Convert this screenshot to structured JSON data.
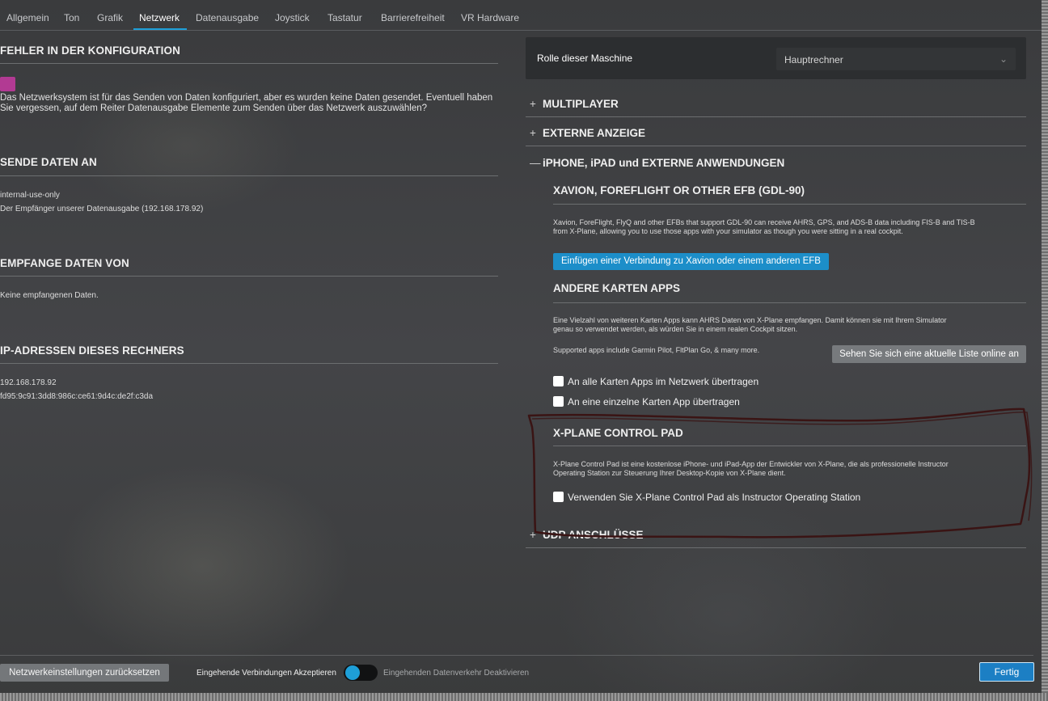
{
  "tabs": [
    "Allgemein",
    "Ton",
    "Grafik",
    "Netzwerk",
    "Datenausgabe",
    "Joystick",
    "Tastatur",
    "Barrierefreiheit",
    "VR Hardware"
  ],
  "active_tab": "Netzwerk",
  "left": {
    "config_error": {
      "title": "FEHLER IN DER KONFIGURATION",
      "line1": "Das Netzwerksystem ist für das Senden von Daten konfiguriert, aber es wurden keine Daten gesendet. Eventuell haben",
      "line2": "Sie vergessen, auf dem Reiter Datenausgabe Elemente zum Senden über das Netzwerk auszuwählen?"
    },
    "send_to": {
      "title": "SENDE DATEN AN",
      "item1": "internal-use-only",
      "item2": "Der Empfänger unserer Datenausgabe (192.168.178.92)"
    },
    "receive_from": {
      "title": "EMPFANGE DATEN VON",
      "item1": "Keine empfangenen Daten."
    },
    "ip": {
      "title": "IP-ADRESSEN DIESES RECHNERS",
      "item1": "192.168.178.92",
      "item2": "fd95:9c91:3dd8:986c:ce61:9d4c:de2f:c3da"
    }
  },
  "right": {
    "role_label": "Rolle dieser Maschine",
    "role_value": "Hauptrechner",
    "sections": {
      "multiplayer": "MULTIPLAYER",
      "external_display": "EXTERNE ANZEIGE",
      "iphone": "iPHONE, iPAD und EXTERNE ANWENDUNGEN",
      "udp": "UDP ANSCHLÜSSE"
    },
    "signs": {
      "plus": "+",
      "minus": "—"
    },
    "xavion": {
      "title": "XAVION, FOREFLIGHT OR OTHER EFB (GDL-90)",
      "line1": "Xavion, ForeFlight, FlyQ and other EFBs that support GDL-90 can receive AHRS, GPS, and ADS-B data including FIS-B and TIS-B",
      "line2": "from X-Plane, allowing you to use those apps with your simulator as though you were sitting in a real cockpit.",
      "button": "Einfügen einer Verbindung zu Xavion oder einem anderen EFB"
    },
    "maps": {
      "title": "ANDERE KARTEN APPS",
      "line1": "Eine Vielzahl von weiteren Karten Apps kann AHRS Daten von X-Plane empfangen. Damit können sie mit Ihrem Simulator",
      "line2": "genau so verwendet werden, als würden Sie in einem realen Cockpit sitzen.",
      "supported": "Supported apps include Garmin Pilot, FltPlan Go, & many more.",
      "list_button": "Sehen Sie sich eine aktuelle Liste online an",
      "check_all": "An alle Karten Apps im Netzwerk übertragen",
      "check_single": "An eine einzelne Karten App übertragen"
    },
    "control_pad": {
      "title": "X-PLANE CONTROL PAD",
      "line1": "X-Plane Control Pad ist eine kostenlose iPhone- und iPad-App der Entwickler von X-Plane, die als professionelle Instructor",
      "line2": "Operating Station zur Steuerung Ihrer Desktop-Kopie von X-Plane dient.",
      "check": "Verwenden Sie X-Plane Control Pad als Instructor Operating Station"
    }
  },
  "bottom": {
    "reset": "Netzwerkeinstellungen zurücksetzen",
    "accept": "Eingehende Verbindungen Akzeptieren",
    "disable": "Eingehenden Datenverkehr Deaktivieren",
    "done": "Fertig"
  },
  "colors": {
    "accent": "#1e9fd8",
    "error_swatch": "#b23a93",
    "annotation": "#3a1414"
  }
}
